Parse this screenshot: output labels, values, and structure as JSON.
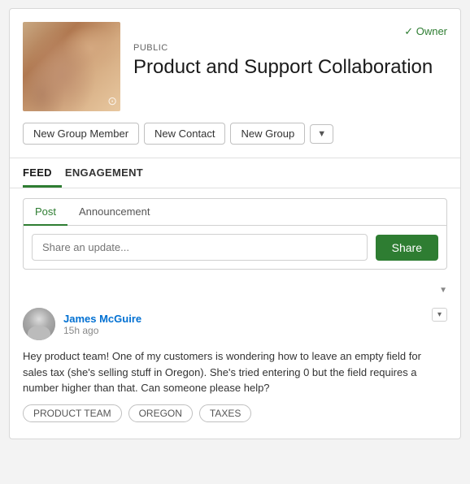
{
  "header": {
    "owner_label": "✓ Owner",
    "public_label": "PUBLIC",
    "group_title": "Product and Support Collaboration",
    "camera_icon": "📷"
  },
  "action_buttons": {
    "new_group_member": "New Group Member",
    "new_contact": "New Contact",
    "new_group": "New Group",
    "dropdown_icon": "▼"
  },
  "tabs": [
    {
      "label": "FEED",
      "active": true
    },
    {
      "label": "ENGAGEMENT",
      "active": false
    }
  ],
  "post_box": {
    "tabs": [
      {
        "label": "Post",
        "active": true
      },
      {
        "label": "Announcement",
        "active": false
      }
    ],
    "input_placeholder": "Share an update...",
    "share_button": "Share"
  },
  "filter": {
    "icon": "▼"
  },
  "posts": [
    {
      "author": "James McGuire",
      "time": "15h ago",
      "body": "Hey product team! One of my customers is wondering how to leave an empty field for sales tax (she's selling stuff in Oregon). She's tried entering 0 but the field requires a number higher than that. Can someone please help?",
      "tags": [
        "PRODUCT TEAM",
        "OREGON",
        "TAXES"
      ]
    }
  ]
}
